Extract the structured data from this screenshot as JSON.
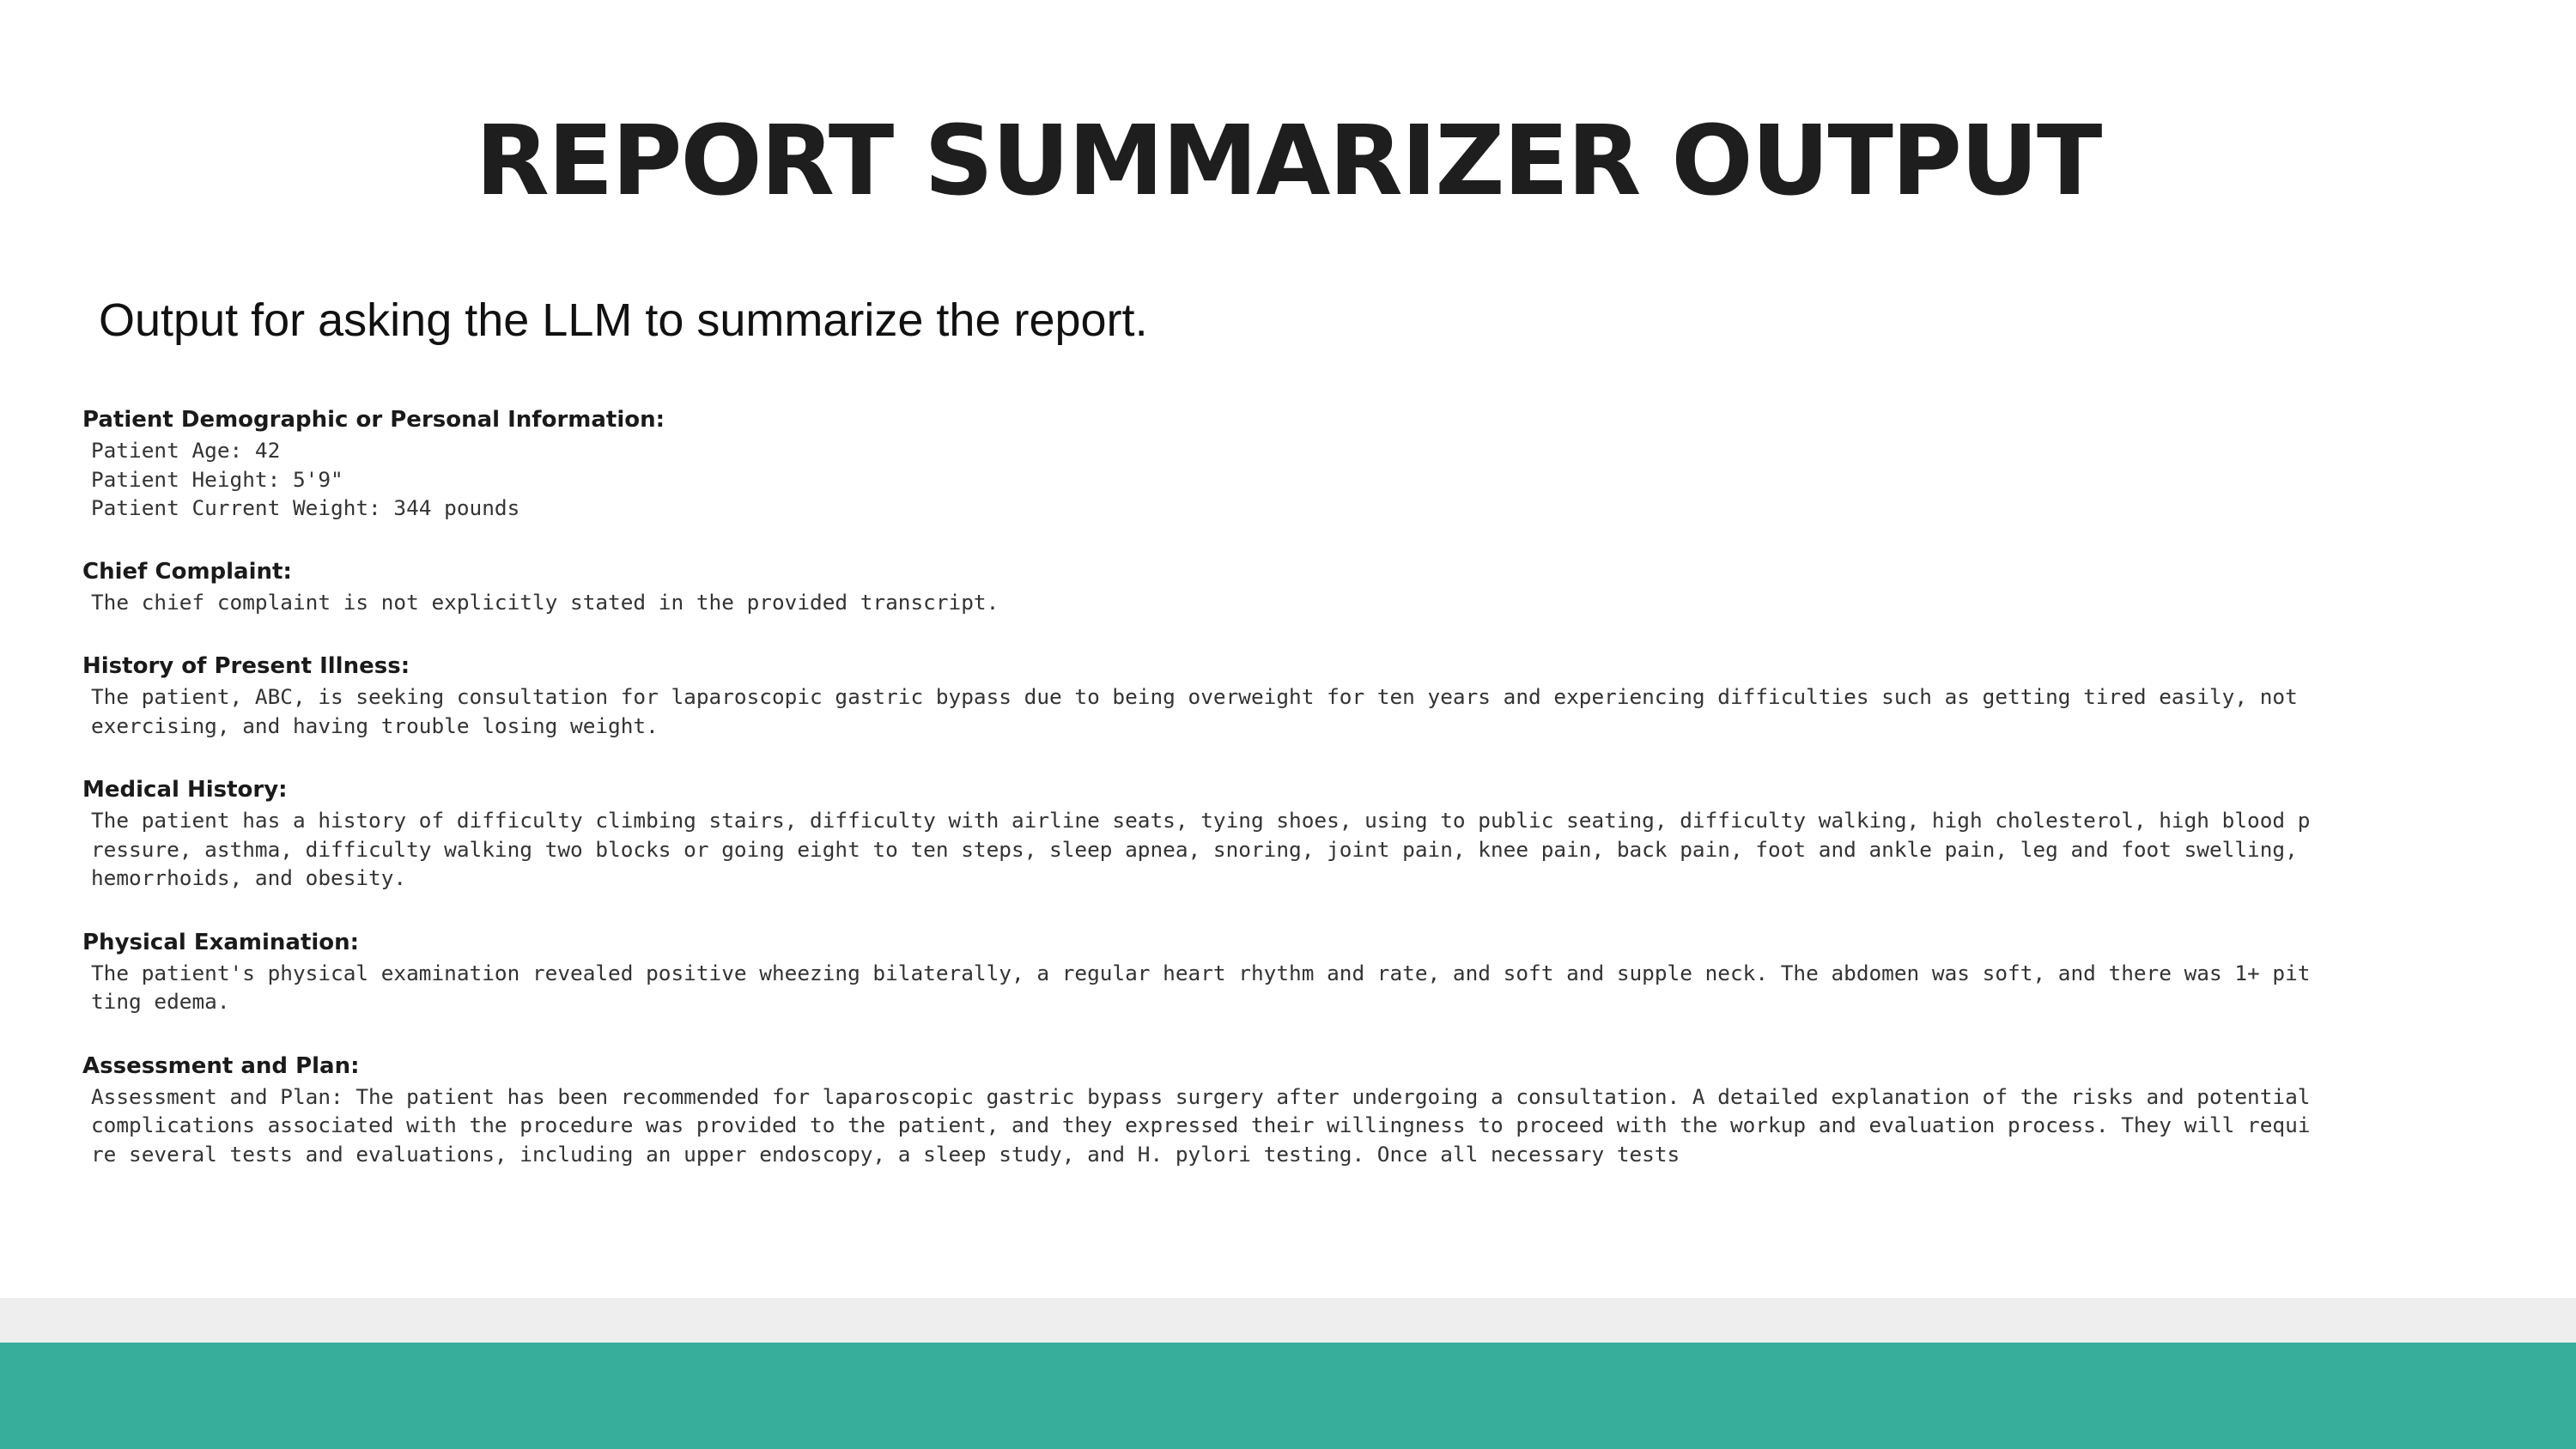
{
  "title": "REPORT SUMMARIZER OUTPUT",
  "subtitle": "Output for asking the LLM to summarize the report.",
  "sections": [
    {
      "heading": "Patient Demographic or Personal Information:",
      "lines": [
        "Patient Age: 42",
        "Patient Height: 5'9\"",
        "Patient Current Weight: 344 pounds"
      ]
    },
    {
      "heading": "Chief Complaint:",
      "lines": [
        "The chief complaint is not explicitly stated in the provided transcript."
      ]
    },
    {
      "heading": "History of Present Illness:",
      "lines": [
        "The patient, ABC, is seeking consultation for laparoscopic gastric bypass due to being overweight for ten years and experiencing difficulties such as getting tired easily, not",
        "exercising, and having trouble losing weight."
      ]
    },
    {
      "heading": "Medical History:",
      "lines": [
        "The patient has a history of difficulty climbing stairs, difficulty with airline seats, tying shoes, using to public seating, difficulty walking, high cholesterol, high blood p",
        "ressure, asthma, difficulty walking two blocks or going eight to ten steps, sleep apnea, snoring, joint pain, knee pain, back pain, foot and ankle pain, leg and foot swelling,",
        "hemorrhoids, and obesity."
      ]
    },
    {
      "heading": "Physical Examination:",
      "lines": [
        "The patient's physical examination revealed positive wheezing bilaterally, a regular heart rhythm and rate, and soft and supple neck. The abdomen was soft, and there was 1+ pit",
        "ting edema."
      ]
    },
    {
      "heading": "Assessment and Plan:",
      "lines": [
        "Assessment and Plan: The patient has been recommended for laparoscopic gastric bypass surgery after undergoing a consultation. A detailed explanation of the risks and potential",
        "complications associated with the procedure was provided to the patient, and they expressed their willingness to proceed with the workup and evaluation process. They will requi",
        "re several tests and evaluations, including an upper endoscopy, a sleep study, and H. pylori testing. Once all necessary tests"
      ]
    }
  ],
  "colors": {
    "footer_accent": "#37ae9b",
    "footer_light": "#eeeeee"
  }
}
